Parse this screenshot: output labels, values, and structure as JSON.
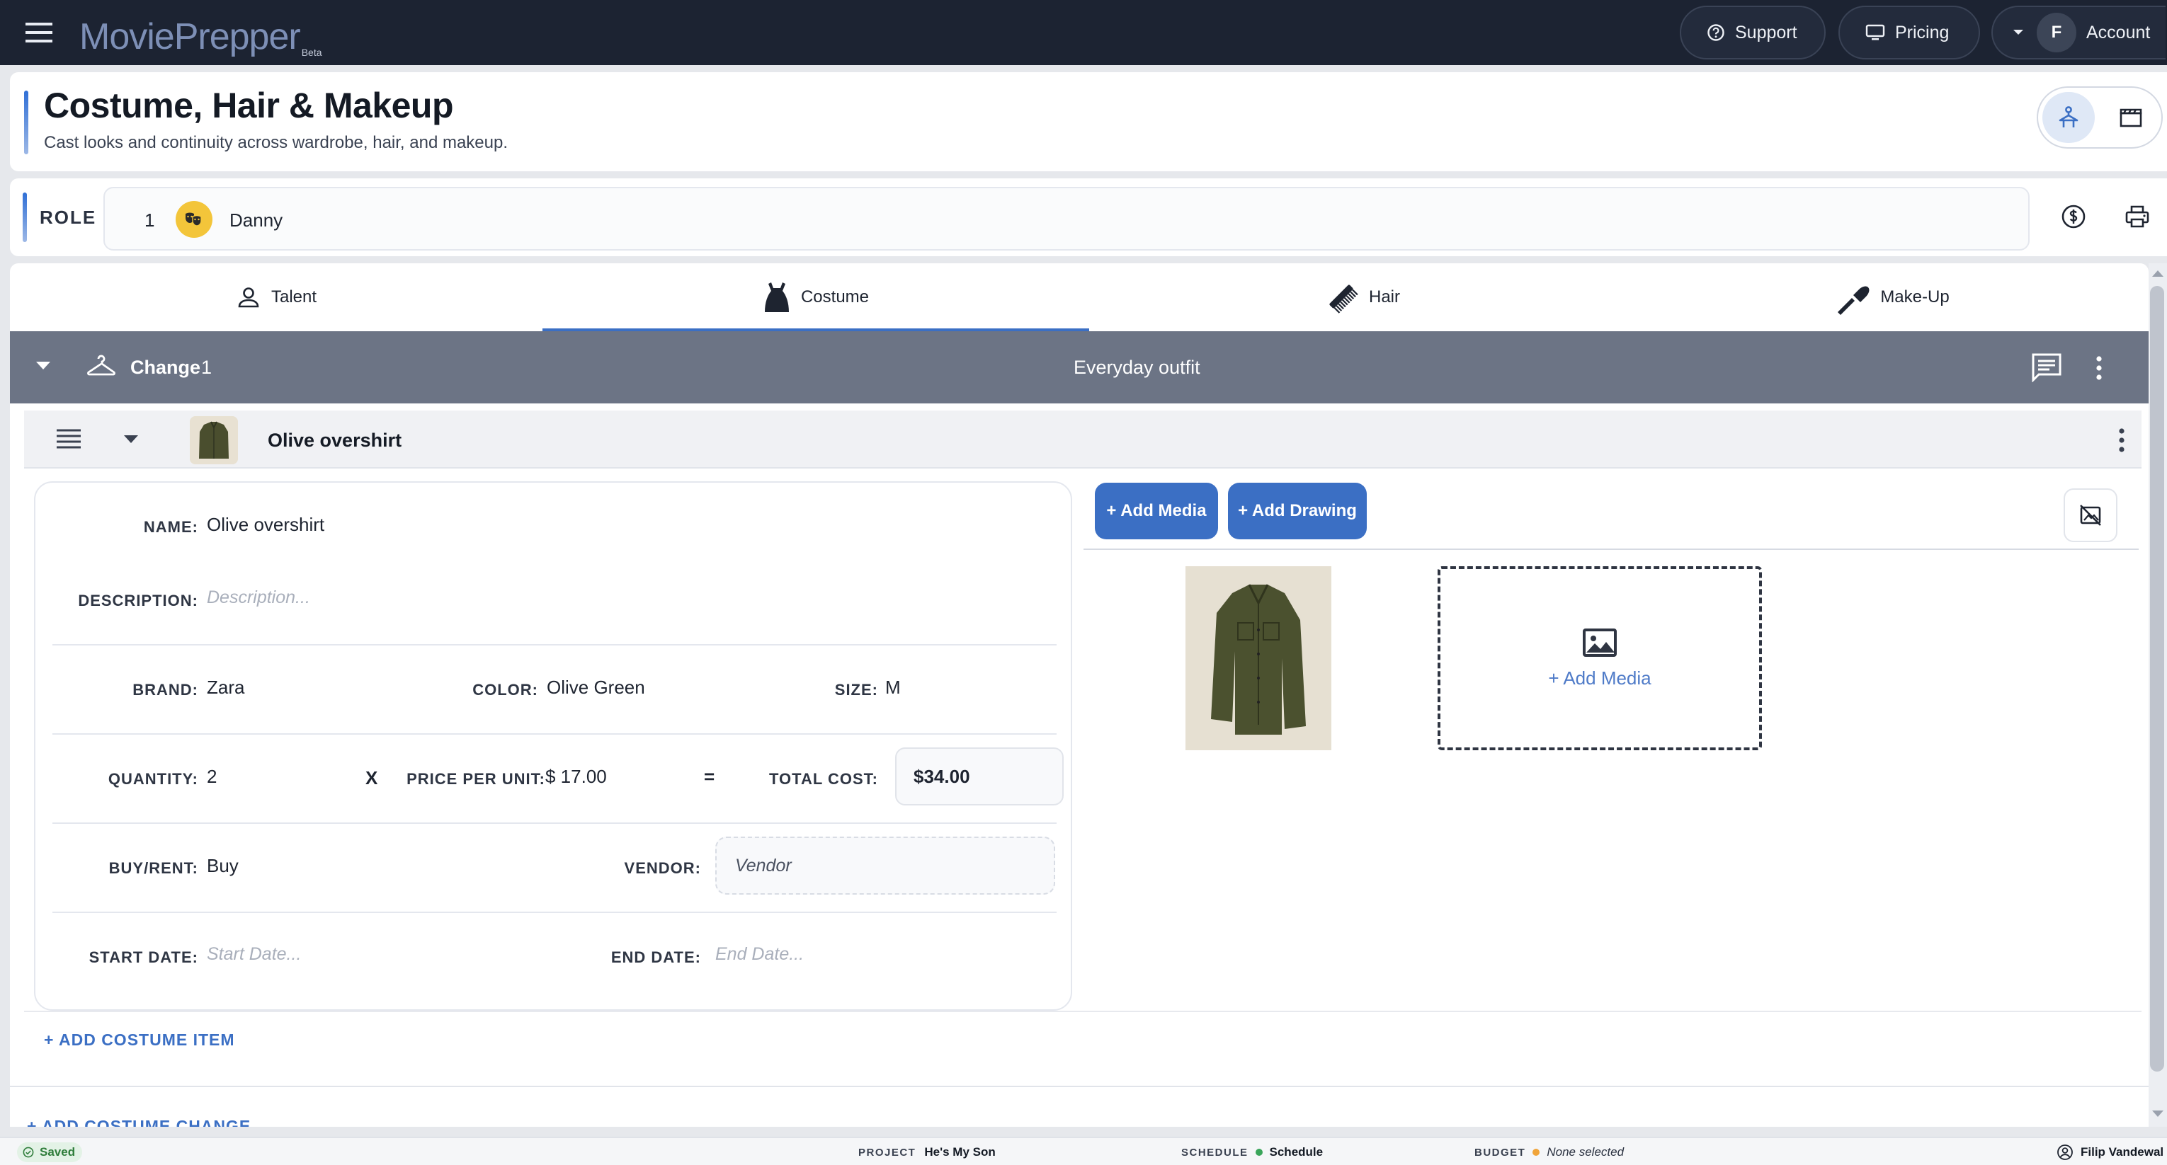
{
  "app": {
    "name": "MoviePrepper",
    "badge": "Beta"
  },
  "topbar": {
    "support_label": "Support",
    "pricing_label": "Pricing",
    "account_initial": "F",
    "account_label": "Account"
  },
  "page": {
    "title": "Costume, Hair & Makeup",
    "subtitle": "Cast looks and continuity across wardrobe, hair, and makeup."
  },
  "role": {
    "label": "ROLE",
    "number": "1",
    "name": "Danny"
  },
  "tabs": [
    {
      "label": "Talent",
      "icon": "person-icon",
      "active": false
    },
    {
      "label": "Costume",
      "icon": "dress-icon",
      "active": true
    },
    {
      "label": "Hair",
      "icon": "comb-icon",
      "active": false
    },
    {
      "label": "Make-Up",
      "icon": "brush-icon",
      "active": false
    }
  ],
  "change": {
    "title": "Change",
    "number": "1",
    "description": "Everyday outfit"
  },
  "item": {
    "title": "Olive overshirt",
    "fields": {
      "name_label": "NAME:",
      "name_value": "Olive overshirt",
      "description_label": "DESCRIPTION:",
      "description_placeholder": "Description...",
      "brand_label": "BRAND:",
      "brand_value": "Zara",
      "color_label": "COLOR:",
      "color_value": "Olive Green",
      "size_label": "SIZE:",
      "size_value": "M",
      "quantity_label": "QUANTITY:",
      "quantity_value": "2",
      "times_sign": "X",
      "price_label": "PRICE PER UNIT:",
      "price_value": "$ 17.00",
      "equals_sign": "=",
      "total_label": "TOTAL COST:",
      "total_value": "$34.00",
      "buyrent_label": "BUY/RENT:",
      "buyrent_value": "Buy",
      "vendor_label": "VENDOR:",
      "vendor_placeholder": "Vendor",
      "start_label": "START DATE:",
      "start_placeholder": "Start Date...",
      "end_label": "END DATE:",
      "end_placeholder": "End Date..."
    }
  },
  "media": {
    "add_media_button": "+ Add Media",
    "add_drawing_button": "+ Add Drawing",
    "dropzone_label": "+ Add Media"
  },
  "actions": {
    "add_costume_item": "+ ADD COSTUME ITEM",
    "add_costume_change": "+ ADD COSTUME CHANGE"
  },
  "footer": {
    "saved": "Saved",
    "project_label": "PROJECT",
    "project_value": "He's My Son",
    "schedule_label": "SCHEDULE",
    "schedule_value": "Schedule",
    "budget_label": "BUDGET",
    "budget_value": "None selected",
    "user": "Filip Vandewal"
  },
  "colors": {
    "topbar": "#1c2332",
    "accent": "#3b6fc4",
    "change_bar": "#6c7485",
    "schedule_dot": "#3aa55a",
    "budget_dot": "#f0a43a"
  }
}
